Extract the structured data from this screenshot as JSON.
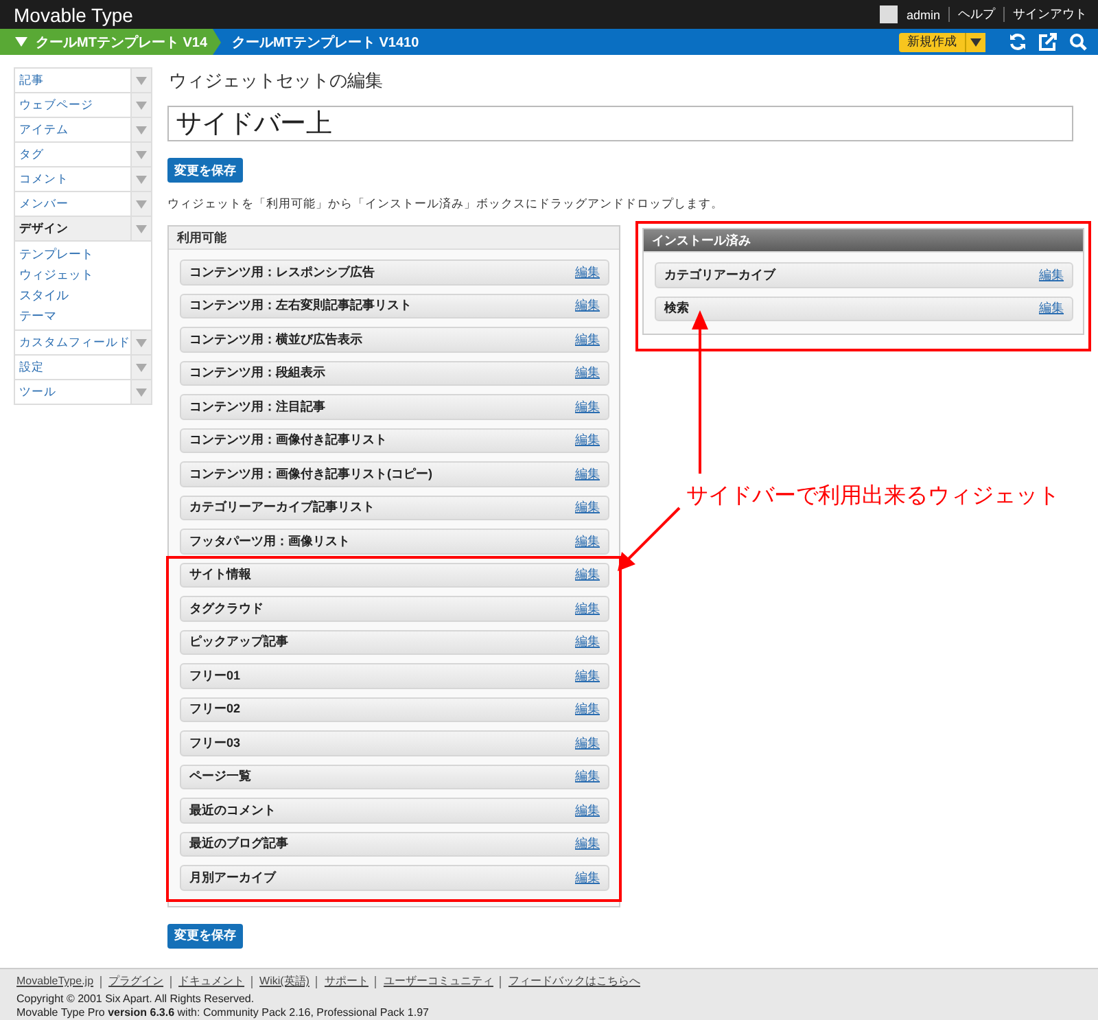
{
  "header": {
    "brand": "Movable Type",
    "user": "admin",
    "links": [
      "ヘルプ",
      "サインアウト"
    ]
  },
  "navbar": {
    "site": "クールMTテンプレート V14",
    "blog": "クールMTテンプレート V1410",
    "new_button": "新規作成"
  },
  "sidebar": {
    "items": [
      {
        "label": "記事",
        "selected": false
      },
      {
        "label": "ウェブページ",
        "selected": false
      },
      {
        "label": "アイテム",
        "selected": false
      },
      {
        "label": "タグ",
        "selected": false
      },
      {
        "label": "コメント",
        "selected": false
      },
      {
        "label": "メンバー",
        "selected": false
      },
      {
        "label": "デザイン",
        "selected": true,
        "children": [
          {
            "label": "テンプレート"
          },
          {
            "label": "ウィジェット"
          },
          {
            "label": "スタイル"
          },
          {
            "label": "テーマ"
          }
        ]
      },
      {
        "label": "カスタムフィールド",
        "selected": false
      },
      {
        "label": "設定",
        "selected": false
      },
      {
        "label": "ツール",
        "selected": false
      }
    ]
  },
  "main": {
    "title": "ウィジェットセットの編集",
    "name_value": "サイドバー上",
    "save_button": "変更を保存",
    "instructions": "ウィジェットを「利用可能」から「インストール済み」ボックスにドラッグアンドドロップします。",
    "available": {
      "title": "利用可能",
      "groups": [
        {
          "highlighted": false,
          "widgets": [
            {
              "name": "コンテンツ用：レスポンシブ広告",
              "action": "編集"
            },
            {
              "name": "コンテンツ用：左右変則記事記事リスト",
              "action": "編集"
            },
            {
              "name": "コンテンツ用：横並び広告表示",
              "action": "編集"
            },
            {
              "name": "コンテンツ用：段組表示",
              "action": "編集"
            },
            {
              "name": "コンテンツ用：注目記事",
              "action": "編集"
            },
            {
              "name": "コンテンツ用：画像付き記事リスト",
              "action": "編集"
            },
            {
              "name": "コンテンツ用：画像付き記事リスト(コピー)",
              "action": "編集"
            },
            {
              "name": "カテゴリーアーカイブ記事リスト",
              "action": "編集"
            },
            {
              "name": "フッタパーツ用：画像リスト",
              "action": "編集"
            }
          ]
        },
        {
          "highlighted": true,
          "widgets": [
            {
              "name": "サイト情報",
              "action": "編集"
            },
            {
              "name": "タグクラウド",
              "action": "編集"
            },
            {
              "name": "ピックアップ記事",
              "action": "編集"
            },
            {
              "name": "フリー01",
              "action": "編集"
            },
            {
              "name": "フリー02",
              "action": "編集"
            },
            {
              "name": "フリー03",
              "action": "編集"
            },
            {
              "name": "ページ一覧",
              "action": "編集"
            },
            {
              "name": "最近のコメント",
              "action": "編集"
            },
            {
              "name": "最近のブログ記事",
              "action": "編集"
            },
            {
              "name": "月別アーカイブ",
              "action": "編集"
            }
          ]
        }
      ]
    },
    "installed": {
      "title": "インストール済み",
      "highlighted": true,
      "widgets": [
        {
          "name": "カテゴリアーカイブ",
          "action": "編集"
        },
        {
          "name": "検索",
          "action": "編集"
        }
      ]
    },
    "save_button_bottom": "変更を保存"
  },
  "annotation": {
    "text": "サイドバーで利用出来るウィジェット"
  },
  "footer": {
    "links": [
      "MovableType.jp",
      "プラグイン",
      "ドキュメント",
      "Wiki(英語)",
      "サポート",
      "ユーザーコミュニティ",
      "フィードバックはこちらへ"
    ],
    "copyright": "Copyright © 2001 Six Apart. All Rights Reserved.",
    "version": "Movable Type Pro **version 6.3.6** with: Community Pack 2.16, Professional Pack 1.97"
  }
}
